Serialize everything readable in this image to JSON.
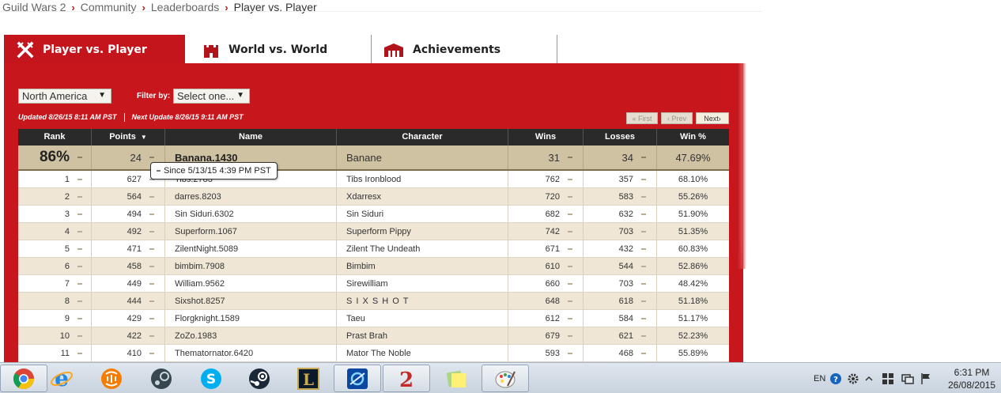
{
  "breadcrumb": [
    "Guild Wars 2",
    "Community",
    "Leaderboards",
    "Player vs. Player"
  ],
  "tabs": [
    {
      "label": "Player vs. Player",
      "icon": "crossed-swords-icon",
      "active": true
    },
    {
      "label": "World vs. World",
      "icon": "castle-icon",
      "active": false
    },
    {
      "label": "Achievements",
      "icon": "building-icon",
      "active": false
    }
  ],
  "filters": {
    "region": "North America",
    "filter_label": "Filter by:",
    "filter_value": "Select one..."
  },
  "updated": {
    "updated_text": "Updated 8/26/15 8:11 AM PST",
    "next_text": "Next Update 8/26/15 9:11 AM PST"
  },
  "pager": {
    "first": "« First",
    "prev": "‹ Prev",
    "next": "Next›"
  },
  "columns": {
    "rank": "Rank",
    "points": "Points",
    "name": "Name",
    "character": "Character",
    "wins": "Wins",
    "losses": "Losses",
    "winpct": "Win %"
  },
  "user_row": {
    "rank": "86%",
    "points": "24",
    "name": "Banana.1430",
    "character": "Banane",
    "wins": "31",
    "losses": "34",
    "winpct": "47.69%"
  },
  "tooltip": "Since 5/13/15 4:39 PM PST",
  "rows": [
    {
      "rank": "1",
      "points": "627",
      "name": "Tibs.2783",
      "character": "Tibs Ironblood",
      "wins": "762",
      "losses": "357",
      "winpct": "68.10%"
    },
    {
      "rank": "2",
      "points": "564",
      "name": "darres.8203",
      "character": "Xdarresx",
      "wins": "720",
      "losses": "583",
      "winpct": "55.26%"
    },
    {
      "rank": "3",
      "points": "494",
      "name": "Sin Siduri.6302",
      "character": "Sin Siduri",
      "wins": "682",
      "losses": "632",
      "winpct": "51.90%"
    },
    {
      "rank": "4",
      "points": "492",
      "name": "Superform.1067",
      "character": "Superform Pippy",
      "wins": "742",
      "losses": "703",
      "winpct": "51.35%"
    },
    {
      "rank": "5",
      "points": "471",
      "name": "ZilentNight.5089",
      "character": "Zilent The Undeath",
      "wins": "671",
      "losses": "432",
      "winpct": "60.83%"
    },
    {
      "rank": "6",
      "points": "458",
      "name": "bimbim.7908",
      "character": "Bimbim",
      "wins": "610",
      "losses": "544",
      "winpct": "52.86%"
    },
    {
      "rank": "7",
      "points": "449",
      "name": "William.9562",
      "character": "Sirewilliam",
      "wins": "660",
      "losses": "703",
      "winpct": "48.42%"
    },
    {
      "rank": "8",
      "points": "444",
      "name": "Sixshot.8257",
      "character": "S I X S H O T",
      "wins": "648",
      "losses": "618",
      "winpct": "51.18%"
    },
    {
      "rank": "9",
      "points": "429",
      "name": "Florgknight.1589",
      "character": "Taeu",
      "wins": "612",
      "losses": "584",
      "winpct": "51.17%"
    },
    {
      "rank": "10",
      "points": "422",
      "name": "ZoZo.1983",
      "character": "Prast Brah",
      "wins": "679",
      "losses": "621",
      "winpct": "52.23%"
    },
    {
      "rank": "11",
      "points": "410",
      "name": "Thematornator.6420",
      "character": "Mator The Noble",
      "wins": "593",
      "losses": "468",
      "winpct": "55.89%"
    }
  ],
  "taskbar": {
    "apps": [
      "chrome-icon",
      "internet-explorer-icon",
      "media-player-icon",
      "steam-alt-icon",
      "skype-icon",
      "steam-icon",
      "league-of-legends-icon",
      "battlenet-icon",
      "guild-wars-2-icon",
      "sticky-notes-icon",
      "paint-icon"
    ],
    "language": "EN",
    "time": "6:31 PM",
    "date": "26/08/2015"
  },
  "colors": {
    "brand_red": "#c8161d",
    "header_dark": "#2a2a2a",
    "user_row": "#cfc2a3",
    "row_alt": "#efe6d5"
  }
}
